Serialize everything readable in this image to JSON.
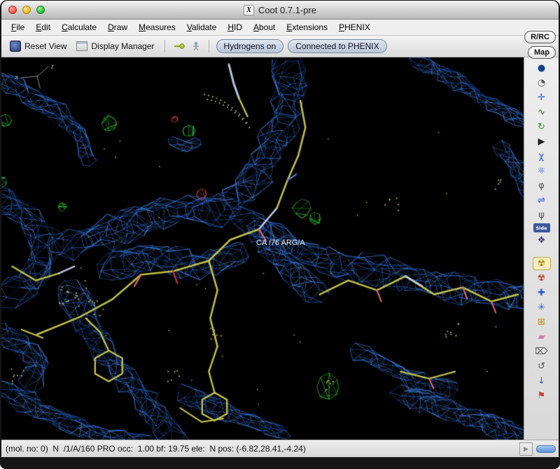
{
  "window": {
    "title": "Coot 0.7.1-pre",
    "x11_icon": "X"
  },
  "menu": {
    "items": [
      {
        "label": "File"
      },
      {
        "label": "Edit"
      },
      {
        "label": "Calculate"
      },
      {
        "label": "Draw"
      },
      {
        "label": "Measures"
      },
      {
        "label": "Validate"
      },
      {
        "label": "HID"
      },
      {
        "label": "About"
      },
      {
        "label": "Extensions"
      },
      {
        "label": "PHENIX"
      }
    ]
  },
  "toolbar": {
    "reset_view": "Reset View",
    "display_manager": "Display Manager",
    "hydrogens": "Hydrogens on",
    "phenix": "Connected to PHENIX"
  },
  "side_buttons": {
    "rrc": "R/RC",
    "map": "Map"
  },
  "viewport": {
    "atom_label": "CA /76 ARG/A",
    "axis_x": "x",
    "axis_z": "z",
    "colors": {
      "background": "#000000",
      "density_map": "#2f78e8",
      "difference_positive": "#27b52c",
      "difference_negative": "#c23434",
      "model_carbon": "#c9c94f",
      "model_main_chain": "#c3cde8",
      "model_nitrogen": "#5577dd",
      "model_oxygen": "#e06878",
      "waters": "#c9b44e"
    }
  },
  "sidebar": {
    "tools": [
      {
        "name": "display-sphere",
        "glyph": "●",
        "color": "#16418f"
      },
      {
        "name": "recent-history",
        "glyph": "◔",
        "color": "#555555"
      },
      {
        "name": "move-molecule",
        "glyph": "✛",
        "color": "#2a5bd0"
      },
      {
        "name": "refine-spring",
        "glyph": "∿",
        "color": "#1d9a28"
      },
      {
        "name": "rotate-translate-zone",
        "glyph": "↻",
        "color": "#1d9a28"
      },
      {
        "name": "run-play",
        "glyph": "▶",
        "color": "#222222"
      },
      {
        "name": "edit-chi-angles",
        "glyph": "χ",
        "color": "#2a5bd0"
      },
      {
        "name": "atom-picker",
        "glyph": "⚛",
        "color": "#2a5bd0"
      },
      {
        "name": "torsion-general",
        "glyph": "φ",
        "color": "#555555"
      },
      {
        "name": "flip-peptide",
        "glyph": "⇌",
        "color": "#2a5bd0"
      },
      {
        "name": "rotamers",
        "glyph": "ψ",
        "color": "#555555"
      },
      {
        "name": "side-chain-180-flip",
        "glyph": "Side",
        "color": "#ffffff",
        "small": true
      },
      {
        "name": "ligand-builder",
        "glyph": "❖",
        "color": "#444466"
      },
      {
        "name": "real-space-refine-zone",
        "glyph": "☢",
        "color": "#a08400",
        "selected": true,
        "gap": true
      },
      {
        "name": "regularize-zone",
        "glyph": "☢",
        "color": "#c03020"
      },
      {
        "name": "add-terminal-residue",
        "glyph": "✚",
        "color": "#2a5bd0"
      },
      {
        "name": "auto-fit-rotamer",
        "glyph": "✳",
        "color": "#2a5bd0"
      },
      {
        "name": "add-alt-conf",
        "glyph": "⊞",
        "color": "#b08f00"
      },
      {
        "name": "simple-mutate",
        "glyph": "▰",
        "color": "#d080a8"
      },
      {
        "name": "delete-item",
        "glyph": "⌦",
        "color": "#555555"
      },
      {
        "name": "undo",
        "glyph": "↺",
        "color": "#555555"
      },
      {
        "name": "go-to-bottom",
        "glyph": "↓",
        "color": "#2a5bd0"
      },
      {
        "name": "flag-tool",
        "glyph": "⚑",
        "color": "#cc4433"
      }
    ]
  },
  "statusbar": {
    "text": "(mol. no: 0)  N  /1/A/160 PRO occ:  1.00 bf: 19.75 ele:  N pos: (-6.82,28.41,-4.24)",
    "expander_icon": "▶"
  }
}
